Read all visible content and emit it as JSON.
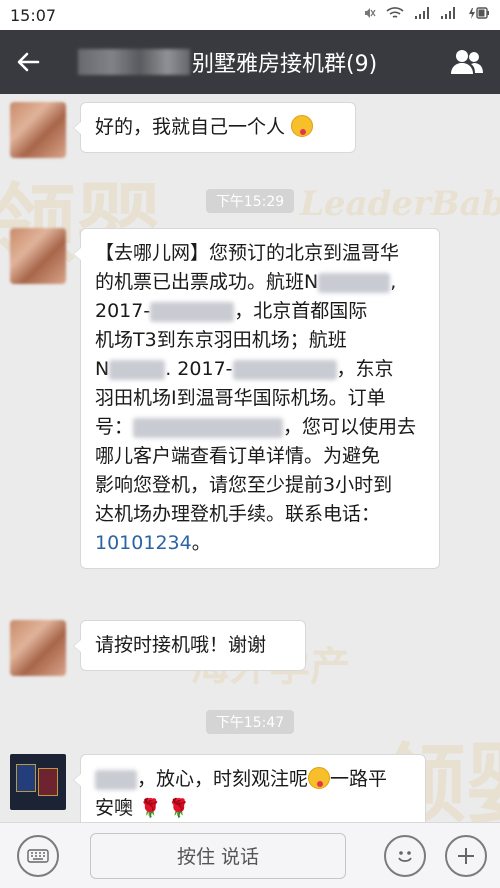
{
  "status_bar": {
    "time": "15:07",
    "icons": [
      "silent-icon",
      "wifi-icon",
      "signal-icon",
      "signal-icon",
      "battery-charging-icon"
    ]
  },
  "header": {
    "title": "别墅雅房接机群(9)",
    "back_icon": "back-arrow-icon",
    "group_icon": "group-members-icon",
    "bg_color": "#393a3f"
  },
  "messages": [
    {
      "type": "text",
      "text_before": "好的，我就自己一个人",
      "emoji": "tongue-out-emoji"
    },
    {
      "type": "timestamp",
      "text": "下午15:29"
    },
    {
      "type": "text",
      "lines": [
        "【去哪儿网】您预订的北京到温哥华",
        "的机票已出票成功。航班N",
        "2017-",
        "，北京首都国际",
        "机场T3到东京羽田机场；航班",
        "N",
        ". 2017-",
        "，东京",
        "羽田机场I到温哥华国际机场。订单",
        "号：",
        "，您可以使用去",
        "哪儿客户端查看订单详情。为避免",
        "影响您登机，请您至少提前3小时到",
        "达机场办理登机手续。联系电话：",
        "10101234",
        "。"
      ],
      "phone": "10101234"
    },
    {
      "type": "text",
      "text": "请按时接机哦！谢谢"
    },
    {
      "type": "timestamp",
      "text": "下午15:47"
    },
    {
      "type": "text",
      "line1_a": "，放心，时刻观注呢",
      "line1_b": "一路平",
      "line2": "安噢",
      "emoji": "tongue-out-emoji",
      "extra_icons": [
        "rose-icon",
        "rose-icon"
      ]
    }
  ],
  "input_bar": {
    "keyboard_icon": "keyboard-icon",
    "hold_to_talk": "按住 说话",
    "emoji_icon": "emoji-icon",
    "plus_icon": "plus-icon"
  },
  "watermark": {
    "brand_cn": "领婴",
    "sub_cn": "海外孕产",
    "brand_en": "LeaderBaby"
  },
  "colors": {
    "chat_bg": "#ebebeb",
    "bubble_bg": "#ffffff",
    "link_blue": "#2c63a6",
    "timestamp_bg": "#d4d4d4"
  }
}
